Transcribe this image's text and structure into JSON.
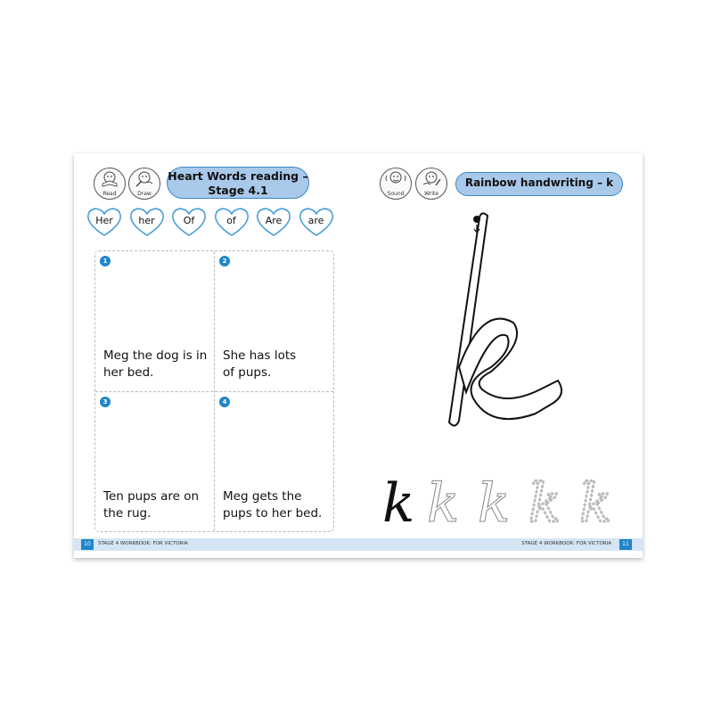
{
  "left_page": {
    "icons": [
      {
        "label": "Read",
        "name": "read-icon"
      },
      {
        "label": "Draw",
        "name": "draw-icon"
      }
    ],
    "title_line1": "Heart Words reading –",
    "title_line2": "Stage 4.1",
    "heart_words": [
      "Her",
      "her",
      "Of",
      "of",
      "Are",
      "are"
    ],
    "panels": [
      {
        "number": "1",
        "line1": "Meg the dog is in",
        "line2": "her bed."
      },
      {
        "number": "2",
        "line1": "She has lots",
        "line2": "of pups."
      },
      {
        "number": "3",
        "line1": "Ten pups are on",
        "line2": "the rug."
      },
      {
        "number": "4",
        "line1": "Meg gets the",
        "line2": "pups to her bed."
      }
    ],
    "footer": {
      "page_number": "10",
      "text": "STAGE 4 WORKBOOK: FOR VICTORIA"
    }
  },
  "right_page": {
    "icons": [
      {
        "label": "Sound",
        "name": "sound-icon"
      },
      {
        "label": "Write",
        "name": "write-icon"
      }
    ],
    "title": "Rainbow handwriting – k",
    "footer": {
      "page_number": "11",
      "text": "STAGE 4 WORKBOOK: FOR VICTORIA"
    }
  },
  "colors": {
    "accent_blue": "#1f86c9",
    "pill_fill": "#a9c9ea",
    "footer_band": "#d5e5f5",
    "heart_outline": "#3d9ad8"
  }
}
